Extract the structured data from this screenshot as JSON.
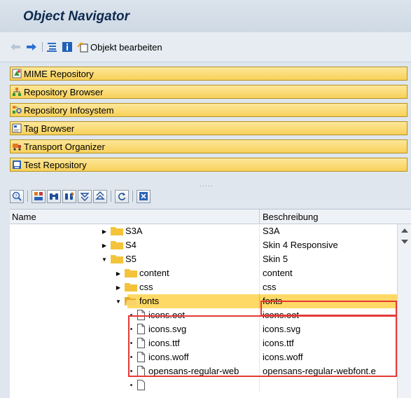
{
  "window": {
    "title": "Object Navigator"
  },
  "toolbar": {
    "edit_object_label": "Objekt bearbeiten"
  },
  "nav": {
    "items": [
      {
        "label": "MIME Repository",
        "icon": "mime-repository-icon"
      },
      {
        "label": "Repository Browser",
        "icon": "repository-browser-icon"
      },
      {
        "label": "Repository Infosystem",
        "icon": "repository-infosystem-icon"
      },
      {
        "label": "Tag Browser",
        "icon": "tag-browser-icon"
      },
      {
        "label": "Transport Organizer",
        "icon": "transport-organizer-icon"
      },
      {
        "label": "Test Repository",
        "icon": "test-repository-icon"
      }
    ]
  },
  "tree": {
    "columns": {
      "name": "Name",
      "description": "Beschreibung"
    },
    "rows": [
      {
        "name": "S3A",
        "description": "S3A"
      },
      {
        "name": "S4",
        "description": "Skin 4 Responsive"
      },
      {
        "name": "S5",
        "description": "Skin 5"
      },
      {
        "name": "content",
        "description": "content"
      },
      {
        "name": "css",
        "description": "css"
      },
      {
        "name": "fonts",
        "description": "fonts"
      },
      {
        "name": "icons.eot",
        "description": "icons.eot"
      },
      {
        "name": "icons.svg",
        "description": "icons.svg"
      },
      {
        "name": "icons.ttf",
        "description": "icons.ttf"
      },
      {
        "name": "icons.woff",
        "description": "icons.woff"
      },
      {
        "name": "opensans-regular-web",
        "description": "opensans-regular-webfont.e"
      }
    ]
  },
  "colors": {
    "highlight": "#ffd966",
    "annotation": "#e53935",
    "folder": "#f3c33a"
  }
}
